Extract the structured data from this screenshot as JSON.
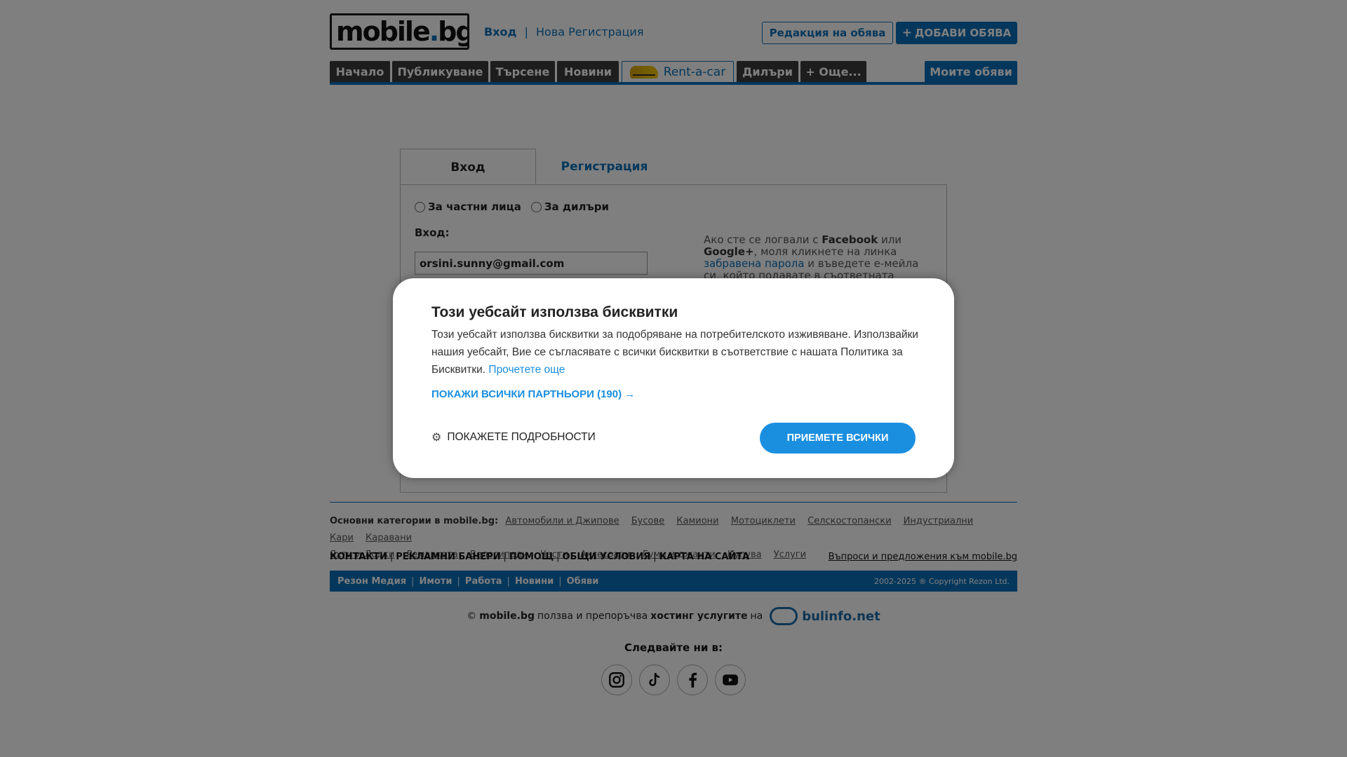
{
  "header": {
    "logo_text": "mobile",
    "logo_dot": ".",
    "logo_tld": "bg",
    "login_link": "Вход",
    "separator": "|",
    "register_link": "Нова Регистрация",
    "edit_ad_button": "Редакция на обява",
    "add_ad_button": "ДОБАВИ ОБЯВА",
    "add_ad_icon": "+"
  },
  "nav": {
    "tabs": [
      {
        "label": "Начало"
      },
      {
        "label": "Публикуване"
      },
      {
        "label": "Търсене"
      },
      {
        "label": "Новини"
      },
      {
        "label": "Rent-a-car"
      },
      {
        "label": "Дилъри"
      },
      {
        "label": "+ Още..."
      }
    ],
    "my_ads": "Моите обяви"
  },
  "login": {
    "tab_login": "Вход",
    "tab_register": "Регистрация",
    "radio_private": "За частни лица",
    "radio_dealers": "За дилъри",
    "login_label": "Вход:",
    "email_value": "orsini.sunny@gmail.com",
    "side_note_1": "Ако сте се логвали с ",
    "side_note_fb": "Facebook",
    "side_note_2": " или ",
    "side_note_g": "Google+",
    "side_note_3": ", моля кликнете на линка ",
    "side_note_link": "забравена парола",
    "side_note_4": " и въведете е-мейла си, който подавате в съответната социална"
  },
  "footer": {
    "categories_head": "Основни категории в mobile.bg:",
    "categories": [
      "Автомобили и Джипове",
      "Бусове",
      "Камиони",
      "Мотоциклети",
      "Селскостопански",
      "Индустриални",
      "Кари",
      "Каравани",
      "Яхти и Лодки",
      "Ремаркета",
      "Велосипеди",
      "Части",
      "Аксесоари",
      "Гуми и джанти",
      "Купува",
      "Услуги"
    ],
    "links": [
      "КОНТАКТИ",
      "РЕКЛАМНИ БАНЕРИ",
      "ПОМОЩ",
      "ОБЩИ УСЛОВИЯ",
      "КАРТА НА САЙТА"
    ],
    "questions_link": "Въпроси и предложения към mobile.bg",
    "bar_links": [
      "Резон Медия",
      "Имоти",
      "Работа",
      "Новини",
      "Обяви"
    ],
    "copyright": "2002-2025 ® Copyright Rezon Ltd.",
    "hosting_prefix": "©",
    "hosting_site": "mobile.bg",
    "hosting_mid": "ползва и препоръчва",
    "hosting_bold": "хостинг услугите",
    "hosting_on": "на",
    "hosting_brand": "bulinfo.net",
    "follow_us": "Следвайте ни в:",
    "social_icons": [
      "instagram-icon",
      "tiktok-icon",
      "facebook-icon",
      "youtube-icon"
    ]
  },
  "cookie_dialog": {
    "title": "Този уебсайт използва бисквитки",
    "text": "Този уебсайт използва бисквитки за подобряване на потребителското изживяване. Използвайки нашия уебсайт, Вие се съгласявате с всички бисквитки в съответствие с нашата Политика за Бисквитки.",
    "read_more": "Прочетете още",
    "show_partners": "ПОКАЖИ ВСИЧКИ ПАРТНЬОРИ (190) →",
    "show_details": "ПОКАЖЕТЕ ПОДРОБНОСТИ",
    "accept_all": "ПРИЕМЕТЕ ВСИЧКИ"
  }
}
